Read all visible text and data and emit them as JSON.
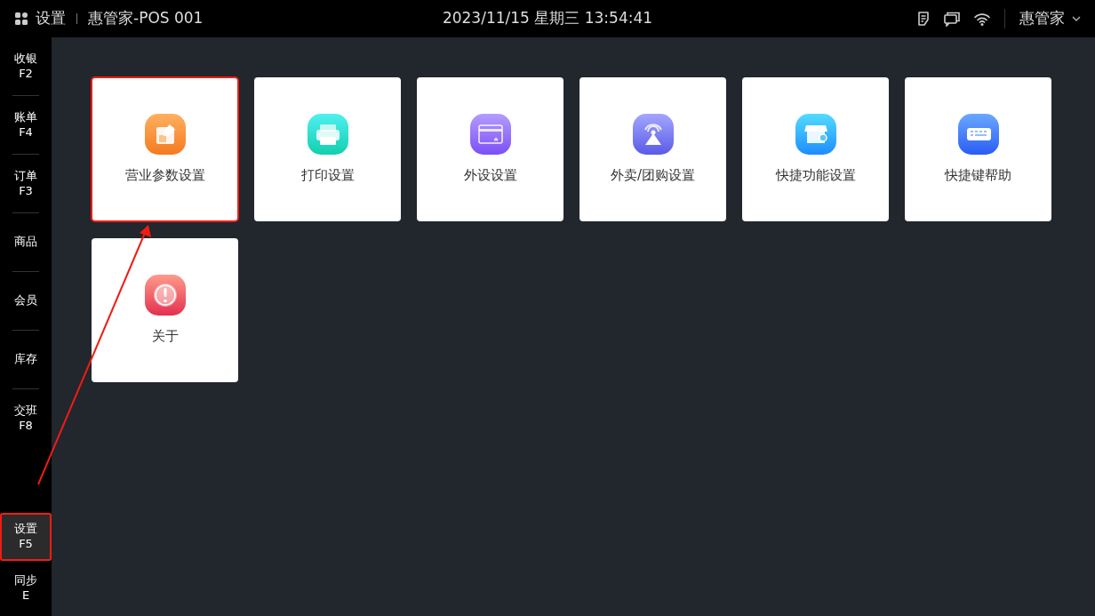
{
  "topbar": {
    "page_title": "设置",
    "device": "惠管家-POS 001",
    "datetime": "2023/11/15 星期三 13:54:41",
    "user": "惠管家"
  },
  "sidebar": {
    "top_items": [
      {
        "label": "收银",
        "key": "F2",
        "selected": false,
        "annotated": false
      },
      {
        "label": "账单",
        "key": "F4",
        "selected": false,
        "annotated": false
      },
      {
        "label": "订单",
        "key": "F3",
        "selected": false,
        "annotated": false
      },
      {
        "label": "商品",
        "selected": false,
        "annotated": false
      },
      {
        "label": "会员",
        "selected": false,
        "annotated": false
      },
      {
        "label": "库存",
        "selected": false,
        "annotated": false
      },
      {
        "label": "交班",
        "key": "F8",
        "selected": false,
        "annotated": false
      }
    ],
    "bottom_items": [
      {
        "label": "设置",
        "key": "F5",
        "selected": true,
        "annotated": true
      },
      {
        "label": "同步",
        "key": "E",
        "selected": false,
        "annotated": false
      }
    ]
  },
  "tiles": [
    {
      "label": "营业参数设置",
      "kind": "edit",
      "annotated": true
    },
    {
      "label": "打印设置",
      "kind": "printer",
      "annotated": false
    },
    {
      "label": "外设设置",
      "kind": "card",
      "annotated": false
    },
    {
      "label": "外卖/团购设置",
      "kind": "broadcast",
      "annotated": false
    },
    {
      "label": "快捷功能设置",
      "kind": "store",
      "annotated": false
    },
    {
      "label": "快捷键帮助",
      "kind": "keyboard",
      "annotated": false
    },
    {
      "label": "关于",
      "kind": "info",
      "annotated": false
    }
  ],
  "annotation_arrow": true
}
